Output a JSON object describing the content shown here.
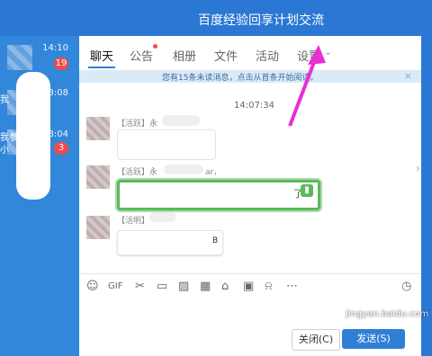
{
  "window": {
    "title": "百度经验回享计划交流"
  },
  "left_panel": {
    "rows": [
      {
        "time": "14:10",
        "badge": "19"
      },
      {
        "time": "8:08",
        "snip": "我"
      },
      {
        "time": "8:04",
        "snip": "我参",
        "snip2": "小",
        "badge": "3"
      }
    ]
  },
  "tabs": [
    {
      "label": "聊天"
    },
    {
      "label": "公告"
    },
    {
      "label": "相册"
    },
    {
      "label": "文件"
    },
    {
      "label": "活动"
    },
    {
      "label": "设置"
    }
  ],
  "notice": {
    "text": "您有15条未读消息，点击从首条开始阅读。",
    "close": "×"
  },
  "chat": {
    "time": "14:07:34",
    "messages": [
      {
        "sender": "【活跃】永"
      },
      {
        "sender": "【活跃】永",
        "sender_tail": "ar，",
        "end_text": "了"
      },
      {
        "sender": "【活明】",
        "glyph": "B"
      }
    ]
  },
  "toolbar_icons": [
    "smile-icon",
    "gif-icon",
    "scissors-icon",
    "folder-icon",
    "image-icon",
    "film-icon",
    "gift-icon",
    "save-icon",
    "bell-icon",
    "more-icon",
    "history-icon"
  ],
  "buttons": {
    "close": "关闭(C)",
    "send": "发送(S)"
  },
  "watermark": "jingyan.baidu.com",
  "colors": {
    "accent": "#2f7fd6",
    "arrow": "#e82fd3"
  }
}
